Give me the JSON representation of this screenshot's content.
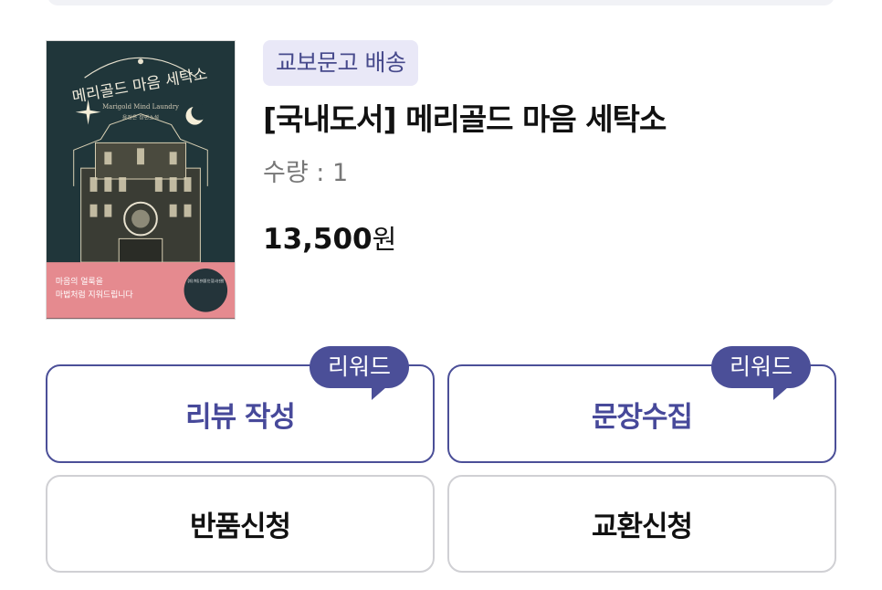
{
  "product": {
    "delivery_badge": "교보문고 배송",
    "title": "[국내도서] 메리골드 마음 세탁소",
    "quantity_label": "수량 : 1",
    "price_value": "13,500",
    "price_unit": "원",
    "cover": {
      "title": "메리골드 마음 세탁소",
      "subtitle": "Marigold Mind Laundry",
      "author": "윤정은 장편소설",
      "tagline_1": "마음의 얼룩을",
      "tagline_2": "마법처럼 지워드립니다",
      "stamp": "김미경, 박미정, 현미정을 잇는 힐링 소설 판권왕"
    }
  },
  "actions": {
    "review_label": "리뷰 작성",
    "review_reward": "리워드",
    "collect_label": "문장수집",
    "collect_reward": "리워드",
    "return_label": "반품신청",
    "exchange_label": "교환신청"
  },
  "colors": {
    "accent": "#4b4f98",
    "badge_bg": "#e9e8f7",
    "cover_bg": "#20363a",
    "cover_band": "#e58a8f"
  }
}
